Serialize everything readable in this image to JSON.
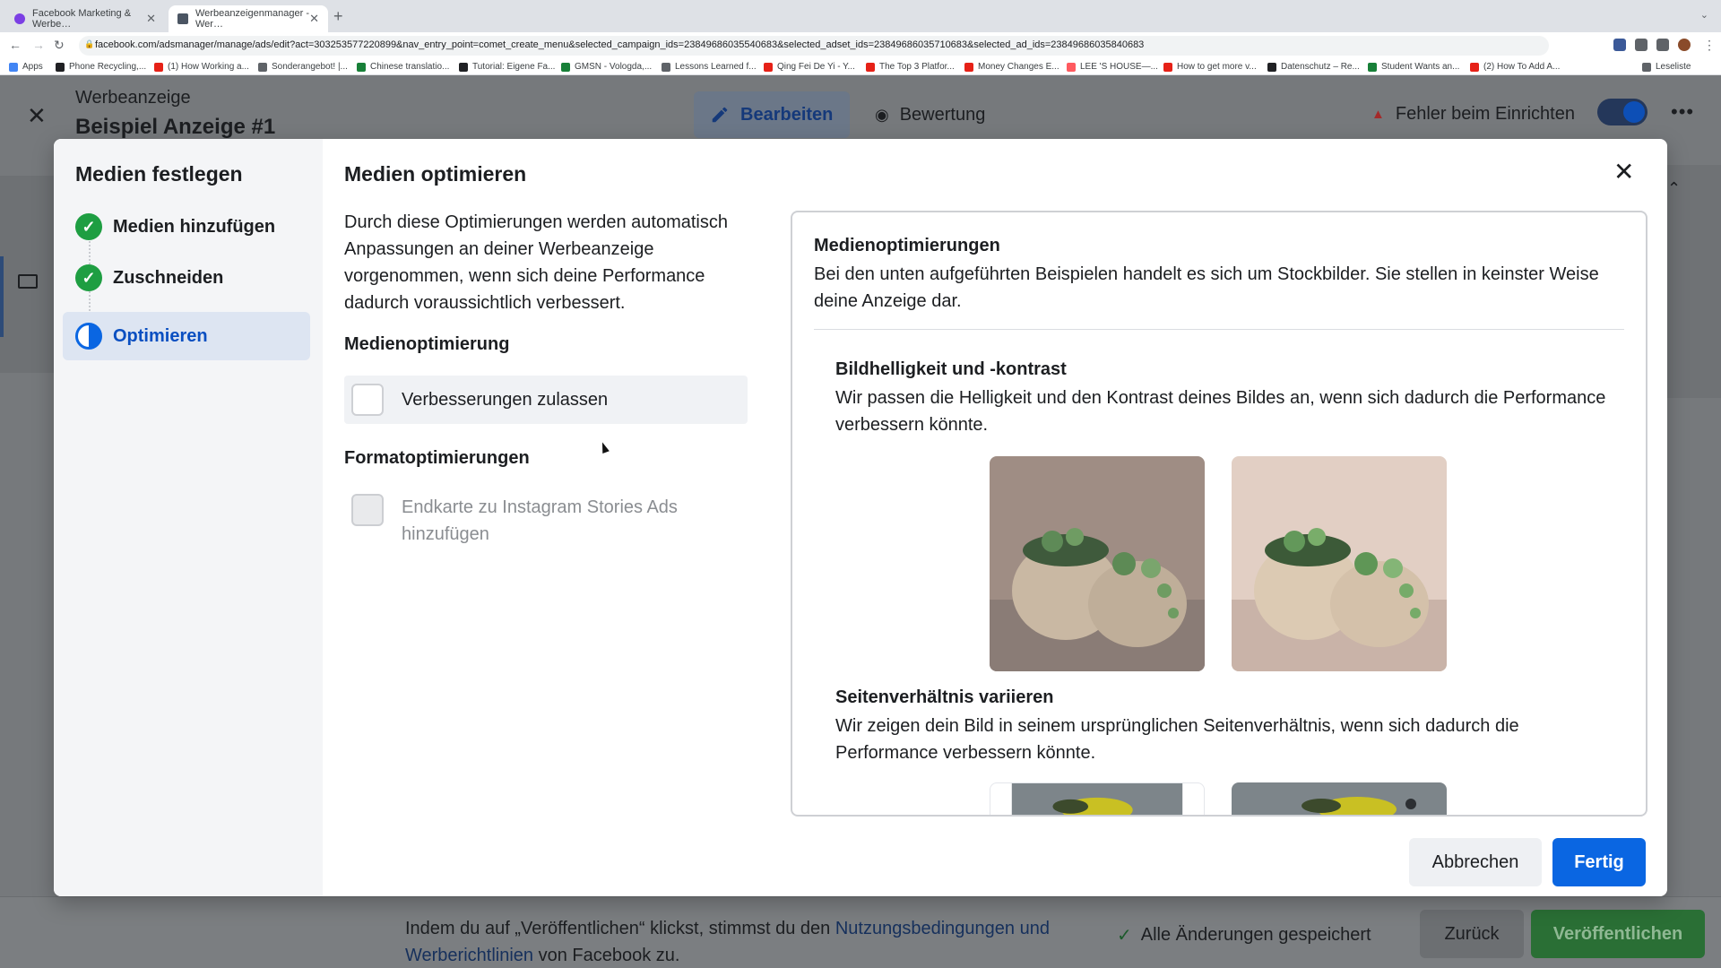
{
  "browser": {
    "tabs": [
      {
        "label": "Facebook Marketing & Werbe…",
        "active": false
      },
      {
        "label": "Werbeanzeigenmanager - Wer…",
        "active": true
      }
    ],
    "new_tab_icon": "plus-icon",
    "url": "facebook.com/adsmanager/manage/ads/edit?act=303253577220899&nav_entry_point=comet_create_menu&selected_campaign_ids=23849686035540683&selected_adset_ids=23849686035710683&selected_ad_ids=23849686035840683",
    "bookmarks": [
      {
        "label": "Apps",
        "color": "#4285f4"
      },
      {
        "label": "Phone Recycling,...",
        "color": "#202124"
      },
      {
        "label": "(1) How Working a...",
        "color": "#e62117"
      },
      {
        "label": "Sonderangebot! |...",
        "color": "#5f6368"
      },
      {
        "label": "Chinese translatio...",
        "color": "#188038"
      },
      {
        "label": "Tutorial: Eigene Fa...",
        "color": "#202124"
      },
      {
        "label": "GMSN - Vologda,...",
        "color": "#188038"
      },
      {
        "label": "Lessons Learned f...",
        "color": "#5f6368"
      },
      {
        "label": "Qing Fei De Yi - Y...",
        "color": "#e62117"
      },
      {
        "label": "The Top 3 Platfor...",
        "color": "#e62117"
      },
      {
        "label": "Money Changes E...",
        "color": "#e62117"
      },
      {
        "label": "LEE 'S HOUSE—...",
        "color": "#ff5a5f"
      },
      {
        "label": "How to get more v...",
        "color": "#e62117"
      },
      {
        "label": "Datenschutz – Re...",
        "color": "#202124"
      },
      {
        "label": "Student Wants an...",
        "color": "#188038"
      },
      {
        "label": "(2) How To Add A...",
        "color": "#e62117"
      }
    ],
    "reading_list": "Leseliste"
  },
  "header": {
    "ad_type": "Werbeanzeige",
    "ad_name": "Beispiel Anzeige #1",
    "edit_label": "Bearbeiten",
    "review_label": "Bewertung",
    "error_label": "Fehler beim Einrichten",
    "toggle_on": true
  },
  "footer": {
    "terms_before": "Indem du auf „Veröffentlichen“ klickst, stimmst du den ",
    "terms_link": "Nutzungsbedingungen und Werberichtlinien",
    "terms_after": " von Facebook zu.",
    "saved_label": "Alle Änderungen gespeichert",
    "back_label": "Zurück",
    "publish_label": "Veröffentlichen"
  },
  "modal": {
    "sidebar": {
      "title": "Medien festlegen",
      "steps": [
        {
          "label": "Medien hinzufügen",
          "status": "done"
        },
        {
          "label": "Zuschneiden",
          "status": "done"
        },
        {
          "label": "Optimieren",
          "status": "active"
        }
      ]
    },
    "title": "Medien optimieren",
    "description": "Durch diese Optimierungen werden automatisch Anpassungen an deiner Werbeanzeige vorgenommen, wenn sich deine Performance dadurch voraussichtlich verbessert.",
    "media_section_title": "Medienoptimierung",
    "media_option": {
      "label": "Verbesserungen zulassen",
      "checked": false
    },
    "format_section_title": "Formatoptimierungen",
    "format_option": {
      "label": "Endkarte zu Instagram Stories Ads hinzufügen",
      "checked": false,
      "disabled": true
    },
    "preview": {
      "title": "Medienoptimierungen",
      "text": "Bei den unten aufgeführten Beispielen handelt es sich um Stockbilder. Sie stellen in keinster Weise deine Anzeige dar.",
      "sections": [
        {
          "title": "Bildhelligkeit und -kontrast",
          "text": "Wir passen die Helligkeit und den Kontrast deines Bildes an, wenn sich dadurch die Performance verbessern könnte."
        },
        {
          "title": "Seitenverhältnis variieren",
          "text": "Wir zeigen dein Bild in seinem ursprünglichen Seitenverhältnis, wenn sich dadurch die Performance verbessern könnte."
        }
      ]
    },
    "cancel_label": "Abbrechen",
    "done_label": "Fertig"
  },
  "colors": {
    "primary": "#0a66e2",
    "success": "#1e9e42",
    "publish": "#2a6f35"
  }
}
